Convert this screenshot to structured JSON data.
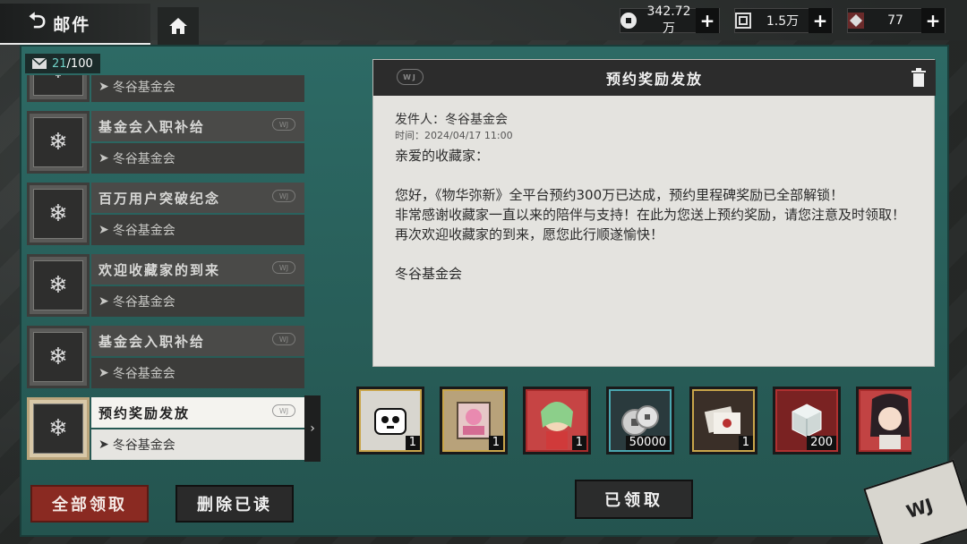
{
  "header": {
    "title": "邮件",
    "currencies": [
      {
        "name": "silver-coin",
        "value": "342.72万"
      },
      {
        "name": "square-token",
        "value": "1.5万"
      },
      {
        "name": "crystal-ticket",
        "value": "77"
      }
    ]
  },
  "mail_count": {
    "current": "21",
    "total": "/100"
  },
  "mails": [
    {
      "subject": "",
      "sender": "冬谷基金会"
    },
    {
      "subject": "基金会入职补给",
      "sender": "冬谷基金会"
    },
    {
      "subject": "百万用户突破纪念",
      "sender": "冬谷基金会"
    },
    {
      "subject": "欢迎收藏家的到来",
      "sender": "冬谷基金会"
    },
    {
      "subject": "基金会入职补给",
      "sender": "冬谷基金会"
    },
    {
      "subject": "预约奖励发放",
      "sender": "冬谷基金会"
    }
  ],
  "actions": {
    "claim_all": "全部领取",
    "delete_read": "删除已读",
    "claimed": "已领取"
  },
  "detail": {
    "title": "预约奖励发放",
    "from": "发件人：冬谷基金会",
    "time": "时间：2024/04/17  11:00",
    "greeting": "亲爱的收藏家：",
    "line1": "您好，《物华弥新》全平台预约300万已达成，预约里程碑奖励已全部解锁！",
    "line2": "非常感谢收藏家一直以来的陪伴与支持！在此为您送上预约奖励，请您注意及时领取！",
    "line3": "再次欢迎收藏家的到来，愿您此行顺遂愉快！",
    "signature": "冬谷基金会"
  },
  "rewards": [
    {
      "item": "panda-avatar",
      "qty": "1"
    },
    {
      "item": "portrait-card",
      "qty": "1"
    },
    {
      "item": "character-card",
      "qty": "1"
    },
    {
      "item": "silver-coins",
      "qty": "50000"
    },
    {
      "item": "letter-bundle",
      "qty": "1"
    },
    {
      "item": "crystal-cube",
      "qty": "200"
    },
    {
      "item": "character-card-2",
      "qty": ""
    }
  ],
  "colors": {
    "accent_teal": "#2f6b66",
    "claim_red": "#8a2a22",
    "gold_frame": "#c9a54a"
  }
}
